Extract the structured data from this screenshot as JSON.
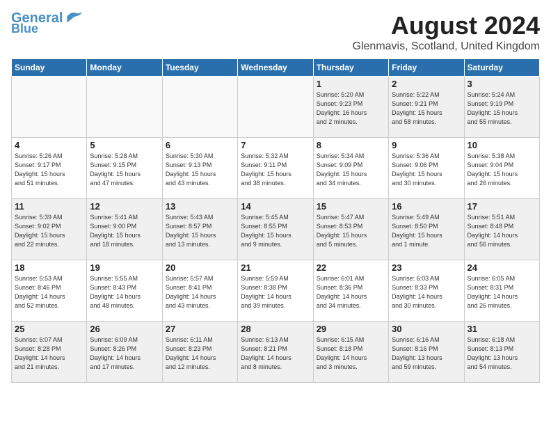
{
  "header": {
    "logo_line1": "General",
    "logo_line2": "Blue",
    "month_year": "August 2024",
    "location": "Glenmavis, Scotland, United Kingdom"
  },
  "weekdays": [
    "Sunday",
    "Monday",
    "Tuesday",
    "Wednesday",
    "Thursday",
    "Friday",
    "Saturday"
  ],
  "weeks": [
    [
      {
        "day": "",
        "info": ""
      },
      {
        "day": "",
        "info": ""
      },
      {
        "day": "",
        "info": ""
      },
      {
        "day": "",
        "info": ""
      },
      {
        "day": "1",
        "info": "Sunrise: 5:20 AM\nSunset: 9:23 PM\nDaylight: 16 hours\nand 2 minutes."
      },
      {
        "day": "2",
        "info": "Sunrise: 5:22 AM\nSunset: 9:21 PM\nDaylight: 15 hours\nand 58 minutes."
      },
      {
        "day": "3",
        "info": "Sunrise: 5:24 AM\nSunset: 9:19 PM\nDaylight: 15 hours\nand 55 minutes."
      }
    ],
    [
      {
        "day": "4",
        "info": "Sunrise: 5:26 AM\nSunset: 9:17 PM\nDaylight: 15 hours\nand 51 minutes."
      },
      {
        "day": "5",
        "info": "Sunrise: 5:28 AM\nSunset: 9:15 PM\nDaylight: 15 hours\nand 47 minutes."
      },
      {
        "day": "6",
        "info": "Sunrise: 5:30 AM\nSunset: 9:13 PM\nDaylight: 15 hours\nand 43 minutes."
      },
      {
        "day": "7",
        "info": "Sunrise: 5:32 AM\nSunset: 9:11 PM\nDaylight: 15 hours\nand 38 minutes."
      },
      {
        "day": "8",
        "info": "Sunrise: 5:34 AM\nSunset: 9:09 PM\nDaylight: 15 hours\nand 34 minutes."
      },
      {
        "day": "9",
        "info": "Sunrise: 5:36 AM\nSunset: 9:06 PM\nDaylight: 15 hours\nand 30 minutes."
      },
      {
        "day": "10",
        "info": "Sunrise: 5:38 AM\nSunset: 9:04 PM\nDaylight: 15 hours\nand 26 minutes."
      }
    ],
    [
      {
        "day": "11",
        "info": "Sunrise: 5:39 AM\nSunset: 9:02 PM\nDaylight: 15 hours\nand 22 minutes."
      },
      {
        "day": "12",
        "info": "Sunrise: 5:41 AM\nSunset: 9:00 PM\nDaylight: 15 hours\nand 18 minutes."
      },
      {
        "day": "13",
        "info": "Sunrise: 5:43 AM\nSunset: 8:57 PM\nDaylight: 15 hours\nand 13 minutes."
      },
      {
        "day": "14",
        "info": "Sunrise: 5:45 AM\nSunset: 8:55 PM\nDaylight: 15 hours\nand 9 minutes."
      },
      {
        "day": "15",
        "info": "Sunrise: 5:47 AM\nSunset: 8:53 PM\nDaylight: 15 hours\nand 5 minutes."
      },
      {
        "day": "16",
        "info": "Sunrise: 5:49 AM\nSunset: 8:50 PM\nDaylight: 15 hours\nand 1 minute."
      },
      {
        "day": "17",
        "info": "Sunrise: 5:51 AM\nSunset: 8:48 PM\nDaylight: 14 hours\nand 56 minutes."
      }
    ],
    [
      {
        "day": "18",
        "info": "Sunrise: 5:53 AM\nSunset: 8:46 PM\nDaylight: 14 hours\nand 52 minutes."
      },
      {
        "day": "19",
        "info": "Sunrise: 5:55 AM\nSunset: 8:43 PM\nDaylight: 14 hours\nand 48 minutes."
      },
      {
        "day": "20",
        "info": "Sunrise: 5:57 AM\nSunset: 8:41 PM\nDaylight: 14 hours\nand 43 minutes."
      },
      {
        "day": "21",
        "info": "Sunrise: 5:59 AM\nSunset: 8:38 PM\nDaylight: 14 hours\nand 39 minutes."
      },
      {
        "day": "22",
        "info": "Sunrise: 6:01 AM\nSunset: 8:36 PM\nDaylight: 14 hours\nand 34 minutes."
      },
      {
        "day": "23",
        "info": "Sunrise: 6:03 AM\nSunset: 8:33 PM\nDaylight: 14 hours\nand 30 minutes."
      },
      {
        "day": "24",
        "info": "Sunrise: 6:05 AM\nSunset: 8:31 PM\nDaylight: 14 hours\nand 26 minutes."
      }
    ],
    [
      {
        "day": "25",
        "info": "Sunrise: 6:07 AM\nSunset: 8:28 PM\nDaylight: 14 hours\nand 21 minutes."
      },
      {
        "day": "26",
        "info": "Sunrise: 6:09 AM\nSunset: 8:26 PM\nDaylight: 14 hours\nand 17 minutes."
      },
      {
        "day": "27",
        "info": "Sunrise: 6:11 AM\nSunset: 8:23 PM\nDaylight: 14 hours\nand 12 minutes."
      },
      {
        "day": "28",
        "info": "Sunrise: 6:13 AM\nSunset: 8:21 PM\nDaylight: 14 hours\nand 8 minutes."
      },
      {
        "day": "29",
        "info": "Sunrise: 6:15 AM\nSunset: 8:18 PM\nDaylight: 14 hours\nand 3 minutes."
      },
      {
        "day": "30",
        "info": "Sunrise: 6:16 AM\nSunset: 8:16 PM\nDaylight: 13 hours\nand 59 minutes."
      },
      {
        "day": "31",
        "info": "Sunrise: 6:18 AM\nSunset: 8:13 PM\nDaylight: 13 hours\nand 54 minutes."
      }
    ]
  ]
}
